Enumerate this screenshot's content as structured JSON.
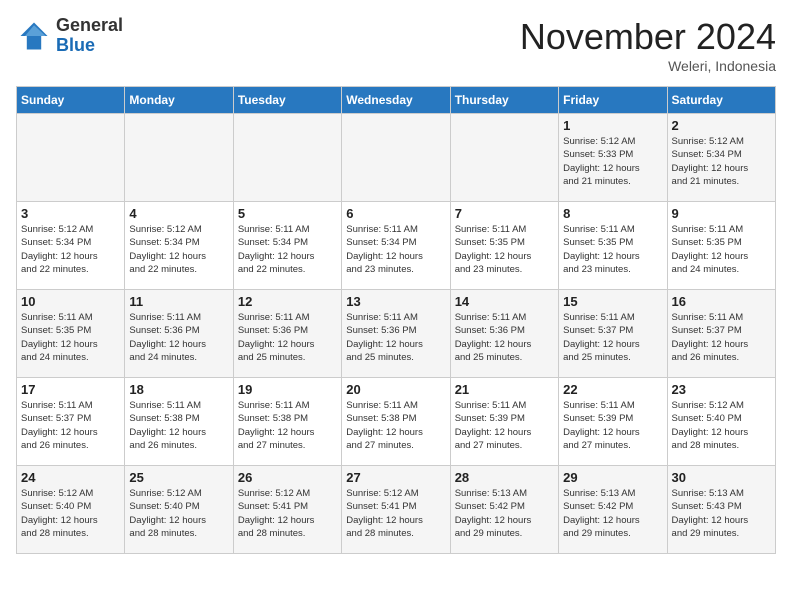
{
  "header": {
    "logo_general": "General",
    "logo_blue": "Blue",
    "month_title": "November 2024",
    "location": "Weleri, Indonesia"
  },
  "days_of_week": [
    "Sunday",
    "Monday",
    "Tuesday",
    "Wednesday",
    "Thursday",
    "Friday",
    "Saturday"
  ],
  "weeks": [
    [
      {
        "day": "",
        "info": ""
      },
      {
        "day": "",
        "info": ""
      },
      {
        "day": "",
        "info": ""
      },
      {
        "day": "",
        "info": ""
      },
      {
        "day": "",
        "info": ""
      },
      {
        "day": "1",
        "info": "Sunrise: 5:12 AM\nSunset: 5:33 PM\nDaylight: 12 hours\nand 21 minutes."
      },
      {
        "day": "2",
        "info": "Sunrise: 5:12 AM\nSunset: 5:34 PM\nDaylight: 12 hours\nand 21 minutes."
      }
    ],
    [
      {
        "day": "3",
        "info": "Sunrise: 5:12 AM\nSunset: 5:34 PM\nDaylight: 12 hours\nand 22 minutes."
      },
      {
        "day": "4",
        "info": "Sunrise: 5:12 AM\nSunset: 5:34 PM\nDaylight: 12 hours\nand 22 minutes."
      },
      {
        "day": "5",
        "info": "Sunrise: 5:11 AM\nSunset: 5:34 PM\nDaylight: 12 hours\nand 22 minutes."
      },
      {
        "day": "6",
        "info": "Sunrise: 5:11 AM\nSunset: 5:34 PM\nDaylight: 12 hours\nand 23 minutes."
      },
      {
        "day": "7",
        "info": "Sunrise: 5:11 AM\nSunset: 5:35 PM\nDaylight: 12 hours\nand 23 minutes."
      },
      {
        "day": "8",
        "info": "Sunrise: 5:11 AM\nSunset: 5:35 PM\nDaylight: 12 hours\nand 23 minutes."
      },
      {
        "day": "9",
        "info": "Sunrise: 5:11 AM\nSunset: 5:35 PM\nDaylight: 12 hours\nand 24 minutes."
      }
    ],
    [
      {
        "day": "10",
        "info": "Sunrise: 5:11 AM\nSunset: 5:35 PM\nDaylight: 12 hours\nand 24 minutes."
      },
      {
        "day": "11",
        "info": "Sunrise: 5:11 AM\nSunset: 5:36 PM\nDaylight: 12 hours\nand 24 minutes."
      },
      {
        "day": "12",
        "info": "Sunrise: 5:11 AM\nSunset: 5:36 PM\nDaylight: 12 hours\nand 25 minutes."
      },
      {
        "day": "13",
        "info": "Sunrise: 5:11 AM\nSunset: 5:36 PM\nDaylight: 12 hours\nand 25 minutes."
      },
      {
        "day": "14",
        "info": "Sunrise: 5:11 AM\nSunset: 5:36 PM\nDaylight: 12 hours\nand 25 minutes."
      },
      {
        "day": "15",
        "info": "Sunrise: 5:11 AM\nSunset: 5:37 PM\nDaylight: 12 hours\nand 25 minutes."
      },
      {
        "day": "16",
        "info": "Sunrise: 5:11 AM\nSunset: 5:37 PM\nDaylight: 12 hours\nand 26 minutes."
      }
    ],
    [
      {
        "day": "17",
        "info": "Sunrise: 5:11 AM\nSunset: 5:37 PM\nDaylight: 12 hours\nand 26 minutes."
      },
      {
        "day": "18",
        "info": "Sunrise: 5:11 AM\nSunset: 5:38 PM\nDaylight: 12 hours\nand 26 minutes."
      },
      {
        "day": "19",
        "info": "Sunrise: 5:11 AM\nSunset: 5:38 PM\nDaylight: 12 hours\nand 27 minutes."
      },
      {
        "day": "20",
        "info": "Sunrise: 5:11 AM\nSunset: 5:38 PM\nDaylight: 12 hours\nand 27 minutes."
      },
      {
        "day": "21",
        "info": "Sunrise: 5:11 AM\nSunset: 5:39 PM\nDaylight: 12 hours\nand 27 minutes."
      },
      {
        "day": "22",
        "info": "Sunrise: 5:11 AM\nSunset: 5:39 PM\nDaylight: 12 hours\nand 27 minutes."
      },
      {
        "day": "23",
        "info": "Sunrise: 5:12 AM\nSunset: 5:40 PM\nDaylight: 12 hours\nand 28 minutes."
      }
    ],
    [
      {
        "day": "24",
        "info": "Sunrise: 5:12 AM\nSunset: 5:40 PM\nDaylight: 12 hours\nand 28 minutes."
      },
      {
        "day": "25",
        "info": "Sunrise: 5:12 AM\nSunset: 5:40 PM\nDaylight: 12 hours\nand 28 minutes."
      },
      {
        "day": "26",
        "info": "Sunrise: 5:12 AM\nSunset: 5:41 PM\nDaylight: 12 hours\nand 28 minutes."
      },
      {
        "day": "27",
        "info": "Sunrise: 5:12 AM\nSunset: 5:41 PM\nDaylight: 12 hours\nand 28 minutes."
      },
      {
        "day": "28",
        "info": "Sunrise: 5:13 AM\nSunset: 5:42 PM\nDaylight: 12 hours\nand 29 minutes."
      },
      {
        "day": "29",
        "info": "Sunrise: 5:13 AM\nSunset: 5:42 PM\nDaylight: 12 hours\nand 29 minutes."
      },
      {
        "day": "30",
        "info": "Sunrise: 5:13 AM\nSunset: 5:43 PM\nDaylight: 12 hours\nand 29 minutes."
      }
    ]
  ]
}
